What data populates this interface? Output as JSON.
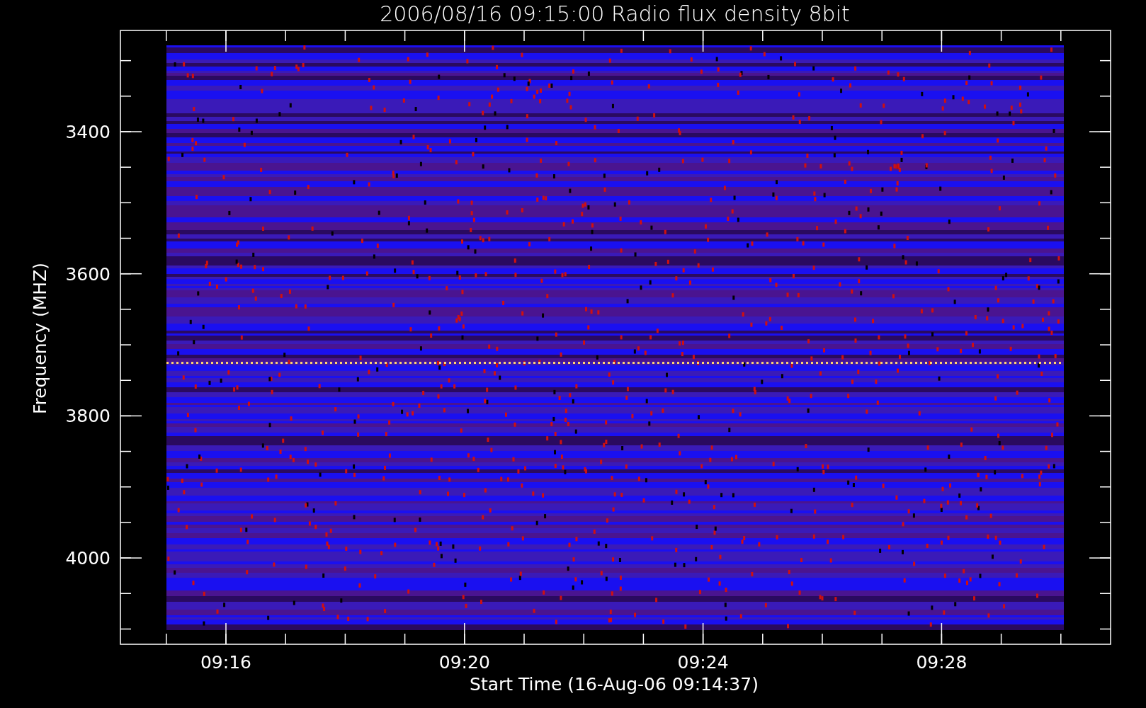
{
  "title": "2006/08/16 09:15:00 Radio flux density 8bit",
  "ylabel": "Frequency (MHZ)",
  "xlabel": "Start Time (16-Aug-06 09:14:37)",
  "yticks": [
    {
      "label": "3400"
    },
    {
      "label": "3600"
    },
    {
      "label": "3800"
    },
    {
      "label": "4000"
    }
  ],
  "xticks": [
    {
      "label": "09:16"
    },
    {
      "label": "09:20"
    },
    {
      "label": "09:24"
    },
    {
      "label": "09:28"
    }
  ]
}
